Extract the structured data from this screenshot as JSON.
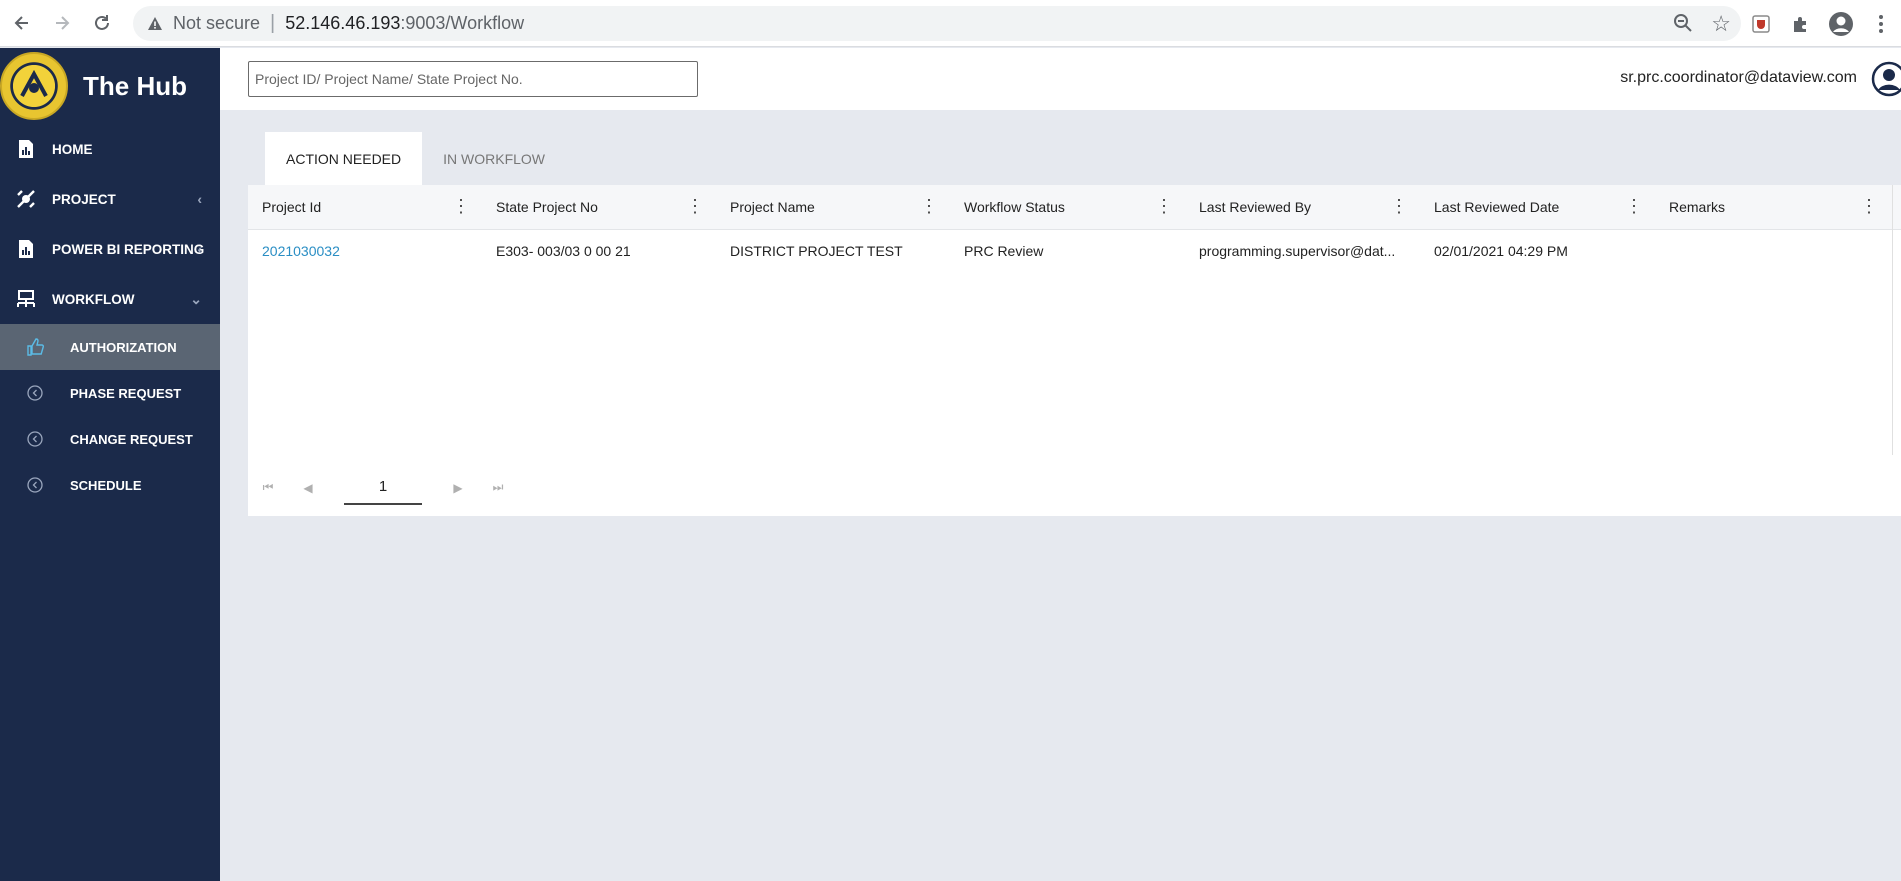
{
  "browser": {
    "not_secure": "Not secure",
    "url_host": "52.146.46.193",
    "url_path": ":9003/Workflow"
  },
  "sidebar": {
    "brand": "The Hub",
    "items": [
      {
        "label": "HOME",
        "icon": "report-icon"
      },
      {
        "label": "PROJECT",
        "icon": "project-icon"
      },
      {
        "label": "POWER BI REPORTING",
        "icon": "chart-doc-icon"
      },
      {
        "label": "WORKFLOW",
        "icon": "workflow-icon"
      }
    ],
    "sub_items": [
      {
        "label": "AUTHORIZATION",
        "icon": "thumbs-up-icon"
      },
      {
        "label": "PHASE REQUEST",
        "icon": "circle-arrow-icon"
      },
      {
        "label": "CHANGE REQUEST",
        "icon": "circle-arrow-icon"
      },
      {
        "label": "SCHEDULE",
        "icon": "circle-arrow-icon"
      }
    ]
  },
  "header": {
    "search_placeholder": "Project ID/ Project Name/ State Project No.",
    "user_email": "sr.prc.coordinator@dataview.com"
  },
  "tabs": [
    "ACTION NEEDED",
    "IN WORKFLOW"
  ],
  "table": {
    "columns": [
      "Project Id",
      "State Project No",
      "Project Name",
      "Workflow Status",
      "Last Reviewed By",
      "Last Reviewed Date",
      "Remarks"
    ],
    "rows": [
      [
        "2021030032",
        "E303- 003/03 0 00 21",
        "DISTRICT PROJECT TEST",
        "PRC Review",
        "programming.supervisor@dat...",
        "02/01/2021 04:29 PM",
        ""
      ]
    ]
  },
  "pager": {
    "current_page": "1"
  },
  "colors": {
    "sidebar": "#1b2a4a",
    "active_item": "#5a6573",
    "link": "#2a8ec4",
    "background": "#e6e9ef"
  }
}
